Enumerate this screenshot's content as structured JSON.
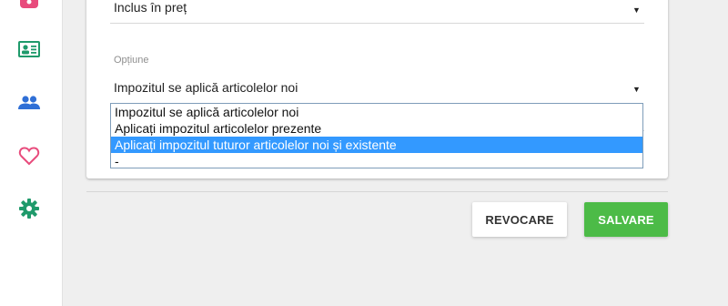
{
  "sidebar": {
    "items": [
      {
        "icon": "bag-icon",
        "color": "#e84b7c"
      },
      {
        "icon": "id-card-icon",
        "color": "#1f9a6b"
      },
      {
        "icon": "people-icon",
        "color": "#2f6fd6"
      },
      {
        "icon": "heart-icon",
        "color": "#e84b7c"
      },
      {
        "icon": "gear-icon",
        "color": "#1f9a6b"
      }
    ]
  },
  "form": {
    "tax_included": {
      "value": "Inclus în preț"
    },
    "option": {
      "label": "Opțiune",
      "value": "Impozitul se aplică articolelor noi",
      "options": [
        "Impozitul se aplică articolelor noi",
        "Aplicați impozitul articolelor prezente",
        "Aplicați impozitul tuturor articolelor noi și existente",
        "-"
      ],
      "highlighted_index": 2
    }
  },
  "actions": {
    "cancel_label": "REVOCARE",
    "save_label": "SALVARE"
  },
  "colors": {
    "accent_green": "#4cbb47",
    "highlight_blue": "#3399ff"
  }
}
